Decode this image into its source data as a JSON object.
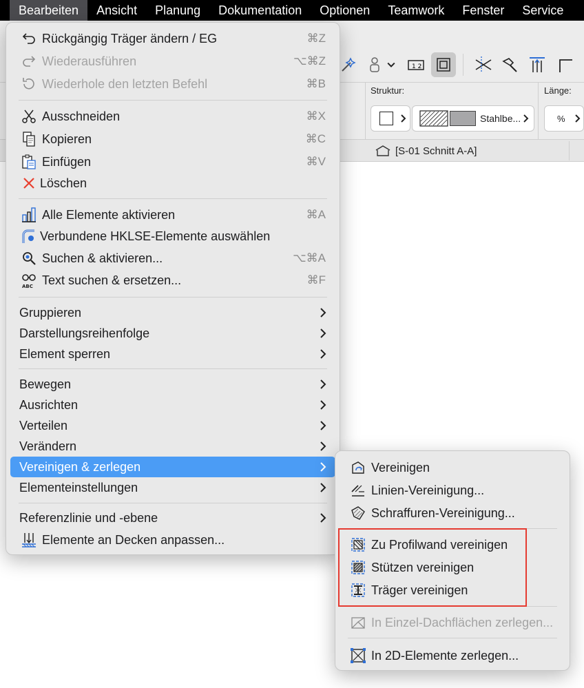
{
  "menubar": {
    "items": [
      "Bearbeiten",
      "Ansicht",
      "Planung",
      "Dokumentation",
      "Optionen",
      "Teamwork",
      "Fenster",
      "Service"
    ]
  },
  "infobox": {
    "struktur_label": "Struktur:",
    "laenge_label": "Länge:",
    "material": "Stahlbe...",
    "percent_symbol": "%"
  },
  "view_tab": {
    "label": "[S-01 Schnitt A-A]"
  },
  "edit_menu": {
    "items": [
      {
        "icon": "undo-icon",
        "label": "Rückgängig Träger ändern / EG",
        "shortcut": "⌘Z",
        "enabled": true
      },
      {
        "icon": "redo-icon",
        "label": "Wiederausführen",
        "shortcut": "⌥⌘Z",
        "enabled": false
      },
      {
        "icon": "repeat-icon",
        "label": "Wiederhole den letzten Befehl",
        "shortcut": "⌘B",
        "enabled": false
      },
      {
        "icon": "scissors-icon",
        "label": "Ausschneiden",
        "shortcut": "⌘X",
        "enabled": true
      },
      {
        "icon": "copy-icon",
        "label": "Kopieren",
        "shortcut": "⌘C",
        "enabled": true
      },
      {
        "icon": "paste-icon",
        "label": "Einfügen",
        "shortcut": "⌘V",
        "enabled": true
      },
      {
        "icon": "delete-x-icon",
        "label": "Löschen",
        "shortcut": "",
        "enabled": true
      },
      {
        "icon": "select-all-icon",
        "label": "Alle Elemente aktivieren",
        "shortcut": "⌘A",
        "enabled": true
      },
      {
        "icon": "mep-connected-icon",
        "label": "Verbundene HKLSE-Elemente auswählen",
        "shortcut": "",
        "enabled": true
      },
      {
        "icon": "find-select-icon",
        "label": "Suchen & aktivieren...",
        "shortcut": "⌥⌘A",
        "enabled": true
      },
      {
        "icon": "find-replace-icon",
        "label": "Text suchen & ersetzen...",
        "shortcut": "⌘F",
        "enabled": true
      },
      {
        "label": "Gruppieren"
      },
      {
        "label": "Darstellungsreihenfolge"
      },
      {
        "label": "Element sperren"
      },
      {
        "label": "Bewegen"
      },
      {
        "label": "Ausrichten"
      },
      {
        "label": "Verteilen"
      },
      {
        "label": "Verändern"
      },
      {
        "label": "Vereinigen & zerlegen",
        "highlighted": true
      },
      {
        "label": "Elementeinstellungen"
      },
      {
        "label": "Referenzlinie und -ebene"
      },
      {
        "icon": "fit-to-slab-icon",
        "label": "Elemente an Decken anpassen...",
        "shortcut": "",
        "enabled": true
      }
    ]
  },
  "submenu": {
    "items": [
      {
        "icon": "merge-icon",
        "label": "Vereinigen",
        "enabled": true
      },
      {
        "icon": "line-merge-icon",
        "label": "Linien-Vereinigung...",
        "enabled": true
      },
      {
        "icon": "fill-merge-icon",
        "label": "Schraffuren-Vereinigung...",
        "enabled": true
      },
      {
        "icon": "profile-wall-icon",
        "label": "Zu Profilwand vereinigen",
        "enabled": true
      },
      {
        "icon": "column-merge-icon",
        "label": "Stützen vereinigen",
        "enabled": true
      },
      {
        "icon": "beam-merge-icon",
        "label": "Träger vereinigen",
        "enabled": true
      },
      {
        "icon": "roof-explode-icon",
        "label": "In Einzel-Dachflächen zerlegen...",
        "enabled": false
      },
      {
        "icon": "explode-2d-icon",
        "label": "In 2D-Elemente zerlegen...",
        "enabled": true
      }
    ]
  },
  "colors": {
    "highlight": "#4b9cf5",
    "annotation_box": "#e53a30",
    "icon_blue": "#2f6fd6"
  }
}
